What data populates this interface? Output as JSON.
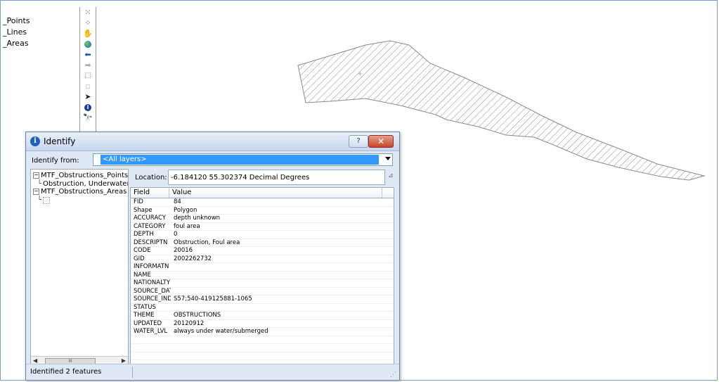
{
  "toc": {
    "items": [
      "_Points",
      "_Lines",
      "_Areas"
    ]
  },
  "tools": {
    "icons": [
      "zoom-in-fixed-icon",
      "zoom-out-fixed-icon",
      "pan-hand-icon",
      "full-extent-globe-icon",
      "back-arrow-icon",
      "forward-arrow-icon",
      "select-features-icon",
      "clear-selection-icon",
      "select-elements-icon",
      "identify-icon",
      "find-binoculars-icon"
    ]
  },
  "dialog": {
    "title": "Identify",
    "help_label": "?",
    "close_label": "✕",
    "identify_from_label": "Identify from:",
    "identify_from_value": "<All layers>",
    "tree": {
      "layer1": "MTF_Obstructions_Points",
      "layer1_child": "Obstruction, Underwater",
      "layer2": "MTF_Obstructions_Areas"
    },
    "location_label": "Location:",
    "location_value": "-6.184120  55.302374 Decimal Degrees",
    "columns": {
      "field": "Field",
      "value": "Value"
    },
    "rows": [
      {
        "field": "FID",
        "value": "84"
      },
      {
        "field": "Shape",
        "value": "Polygon"
      },
      {
        "field": "ACCURACY",
        "value": "depth unknown"
      },
      {
        "field": "CATEGORY",
        "value": "foul area"
      },
      {
        "field": "DEPTH",
        "value": "0"
      },
      {
        "field": "DESCRIPTN",
        "value": "Obstruction, Foul area"
      },
      {
        "field": "CODE",
        "value": "20016"
      },
      {
        "field": "GID",
        "value": "2002262732"
      },
      {
        "field": "INFORMATN",
        "value": ""
      },
      {
        "field": "NAME",
        "value": ""
      },
      {
        "field": "NATIONALTY",
        "value": ""
      },
      {
        "field": "SOURCE_DAT",
        "value": ""
      },
      {
        "field": "SOURCE_IND",
        "value": "S57;540-419125881-1065"
      },
      {
        "field": "STATUS",
        "value": ""
      },
      {
        "field": "THEME",
        "value": "OBSTRUCTIONS"
      },
      {
        "field": "UPDATED",
        "value": "20120912"
      },
      {
        "field": "WATER_LVL",
        "value": "always under water/submerged"
      }
    ],
    "status": "Identified 2 features"
  },
  "colors": {
    "selection": "#3399ff",
    "close_button": "#c8452a",
    "dialog_bg": "#dfe8f5"
  }
}
